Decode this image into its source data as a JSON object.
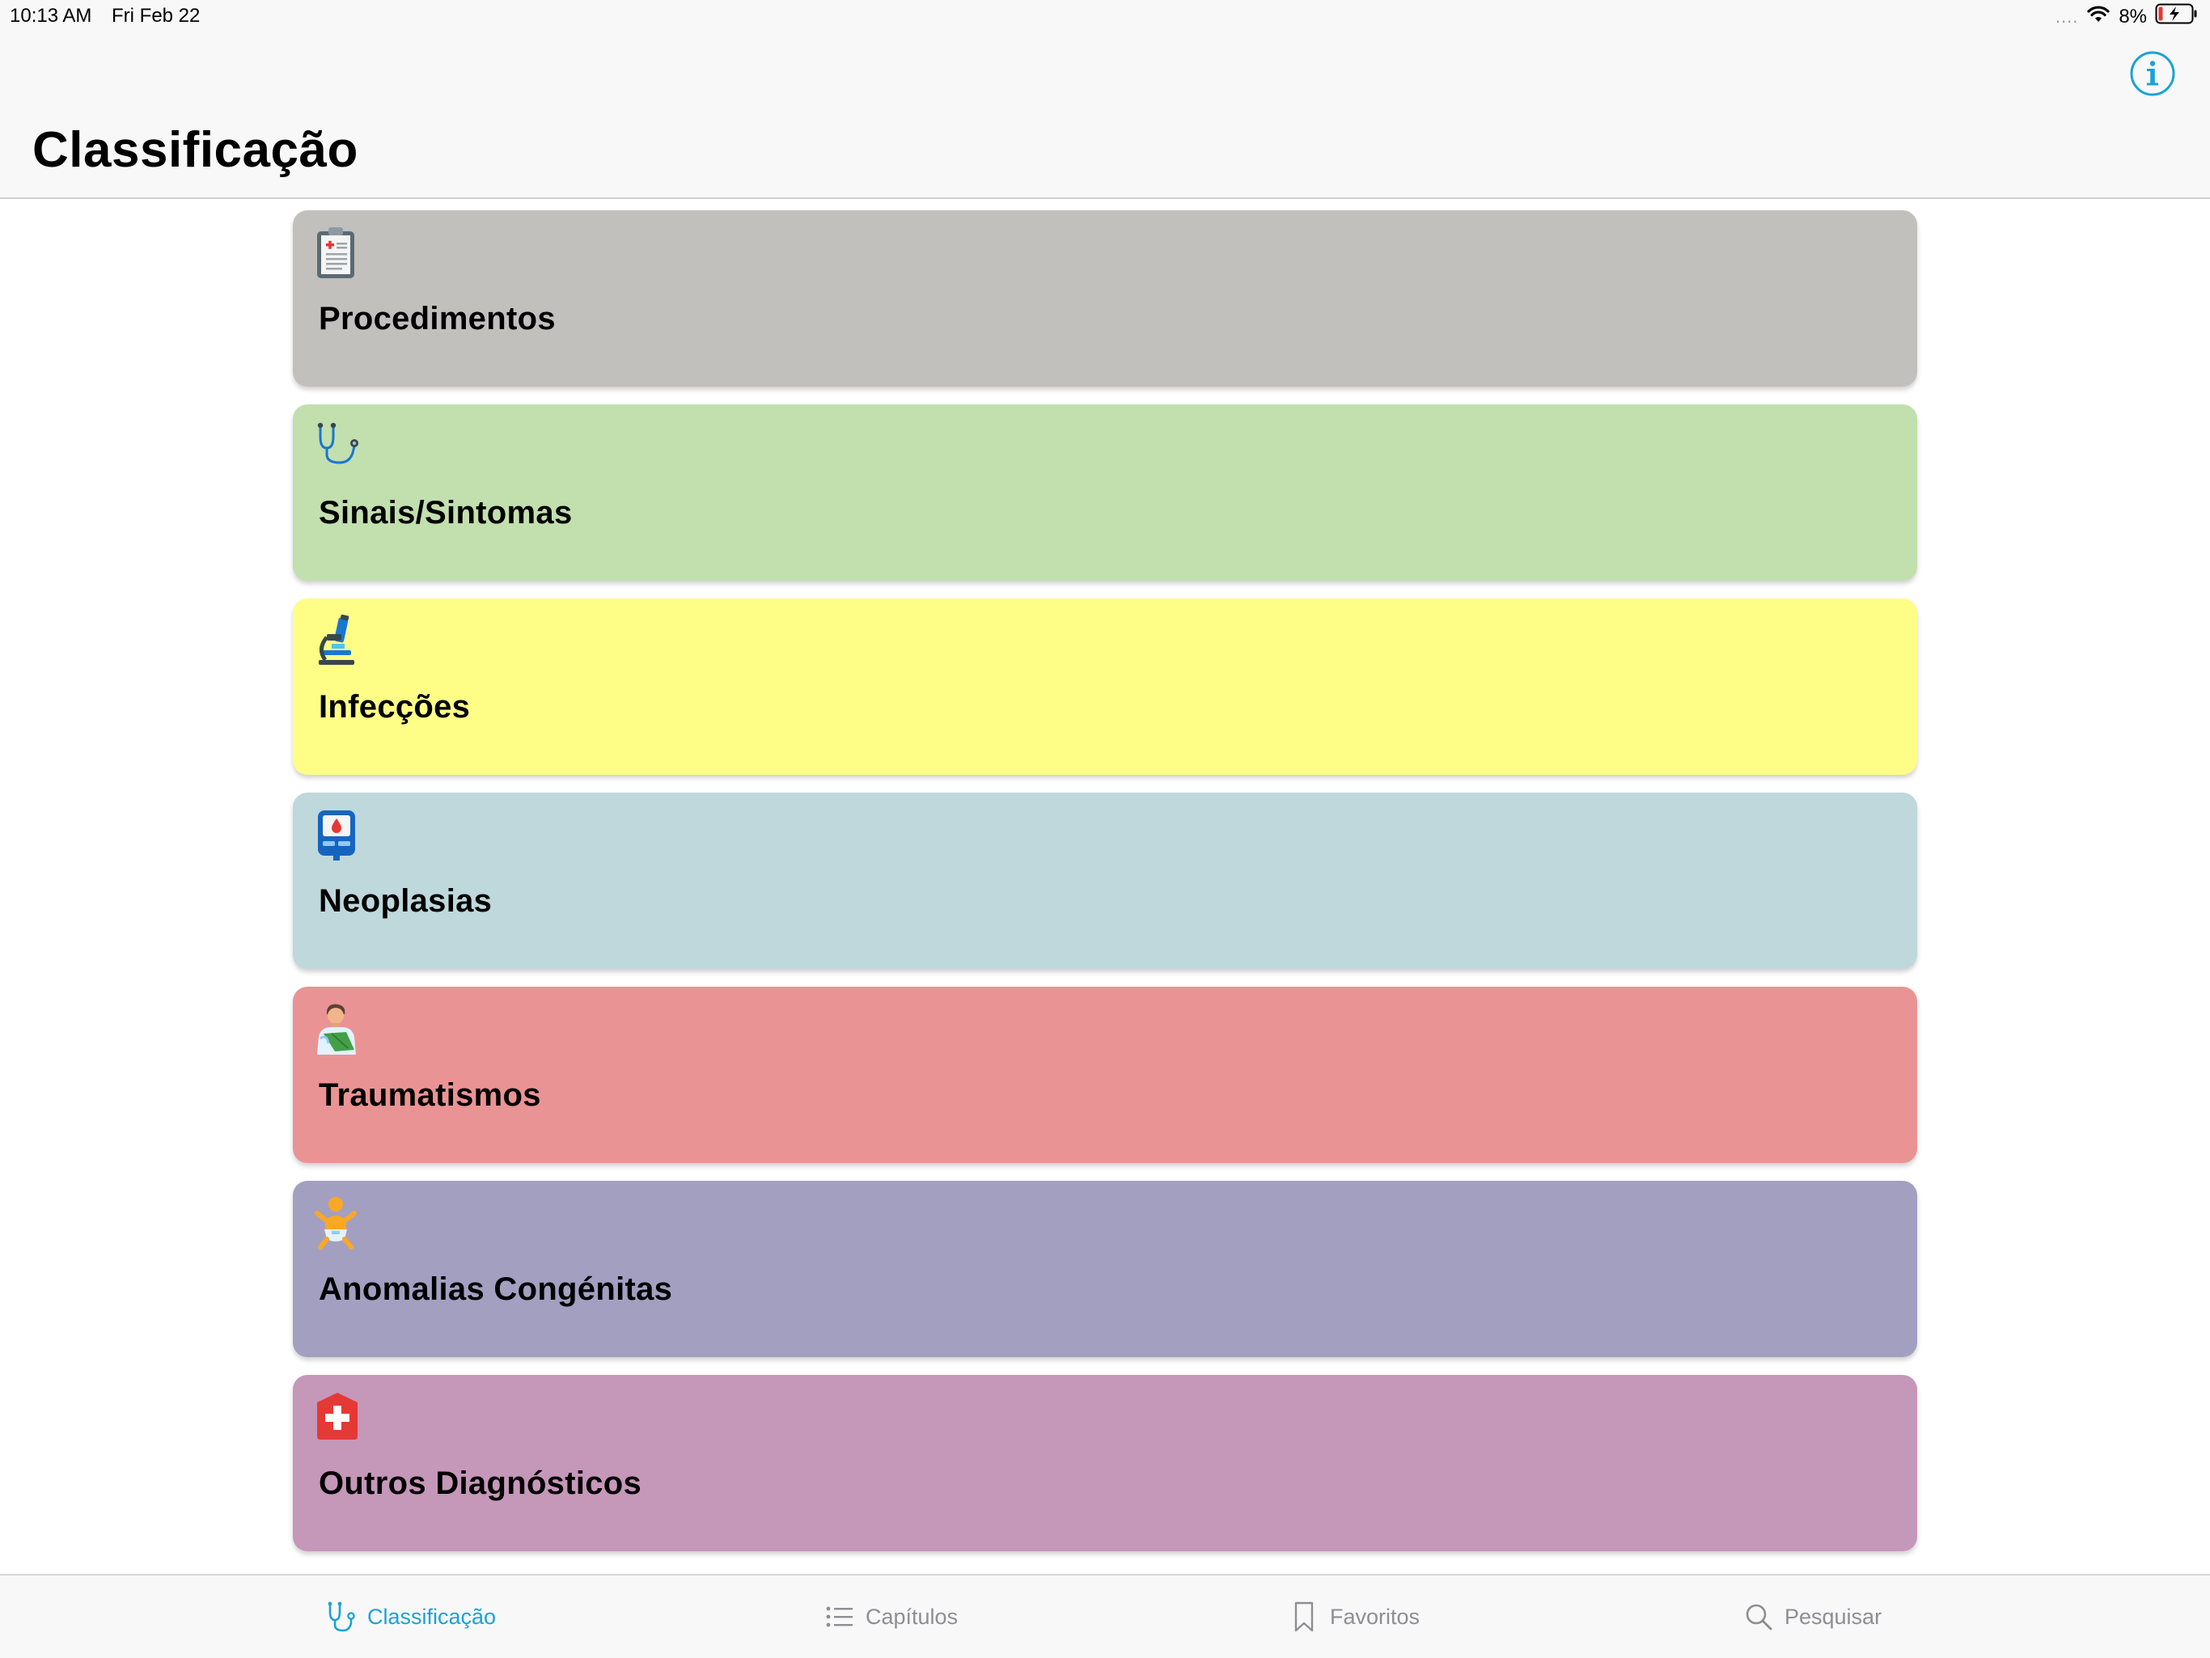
{
  "status_bar": {
    "time": "10:13 AM",
    "date": "Fri Feb 22",
    "signal": "....",
    "battery": "8%"
  },
  "nav": {
    "title": "Classificação",
    "info_icon": "info-icon"
  },
  "categories": [
    {
      "label": "Procedimentos",
      "color": "#c1c0bc",
      "icon": "clipboard-icon"
    },
    {
      "label": "Sinais/Sintomas",
      "color": "#c2dfae",
      "icon": "stethoscope-icon"
    },
    {
      "label": "Infecções",
      "color": "#fefe87",
      "icon": "microscope-icon"
    },
    {
      "label": "Neoplasias",
      "color": "#bed8dc",
      "icon": "blood-glucose-meter-icon"
    },
    {
      "label": "Traumatismos",
      "color": "#ea9394",
      "icon": "injured-person-icon"
    },
    {
      "label": "Anomalias Congénitas",
      "color": "#a39fc1",
      "icon": "baby-icon"
    },
    {
      "label": "Outros Diagnósticos",
      "color": "#c597b9",
      "icon": "hospital-cross-icon"
    }
  ],
  "tabs": [
    {
      "label": "Classificação",
      "icon": "stethoscope-icon",
      "active": true
    },
    {
      "label": "Capítulos",
      "icon": "list-icon",
      "active": false
    },
    {
      "label": "Favoritos",
      "icon": "bookmark-icon",
      "active": false
    },
    {
      "label": "Pesquisar",
      "icon": "search-icon",
      "active": false
    }
  ],
  "colors": {
    "accent": "#1aa3d6",
    "inactive_tab": "#8e8e93",
    "battery_low": "#e53935"
  }
}
